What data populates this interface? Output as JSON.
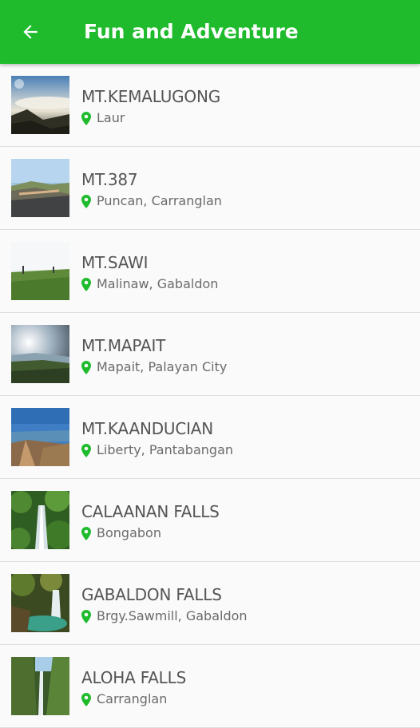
{
  "header": {
    "title": "Fun and Adventure",
    "back_icon": "arrow-back-icon",
    "bar_color": "#1fbb2d"
  },
  "colors": {
    "accent": "#1fbb2d",
    "pin": "#1fbb2d",
    "title_text": "#555555",
    "location_text": "#6b6b6b",
    "divider": "#dedede"
  },
  "items": [
    {
      "name": "MT.KEMALUGONG",
      "location": "Laur",
      "pin_icon": "location-pin-icon"
    },
    {
      "name": "MT.387",
      "location": "Puncan, Carranglan",
      "pin_icon": "location-pin-icon"
    },
    {
      "name": "MT.SAWI",
      "location": "Malinaw, Gabaldon",
      "pin_icon": "location-pin-icon"
    },
    {
      "name": "MT.MAPAIT",
      "location": "Mapait, Palayan City",
      "pin_icon": "location-pin-icon"
    },
    {
      "name": "MT.KAANDUCIAN",
      "location": "Liberty, Pantabangan",
      "pin_icon": "location-pin-icon"
    },
    {
      "name": "CALAANAN FALLS",
      "location": "Bongabon",
      "pin_icon": "location-pin-icon"
    },
    {
      "name": "GABALDON FALLS",
      "location": "Brgy.Sawmill, Gabaldon",
      "pin_icon": "location-pin-icon"
    },
    {
      "name": "ALOHA FALLS",
      "location": "Carranglan",
      "pin_icon": "location-pin-icon"
    }
  ]
}
